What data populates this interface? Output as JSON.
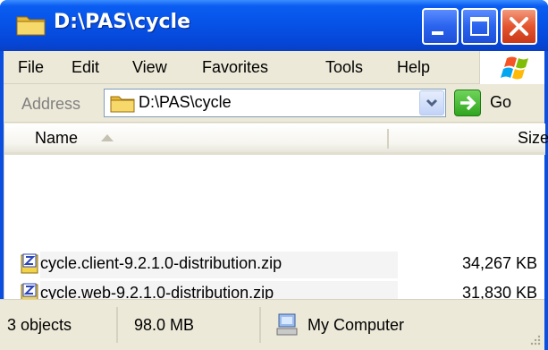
{
  "window": {
    "title": "D:\\PAS\\cycle",
    "controls": [
      "minimize",
      "maximize",
      "close"
    ]
  },
  "menu": {
    "items": [
      "File",
      "Edit",
      "View",
      "Favorites",
      "Tools",
      "Help"
    ]
  },
  "address_bar": {
    "label": "Address",
    "value": "D:\\PAS\\cycle",
    "go_label": "Go"
  },
  "list": {
    "columns": {
      "name": "Name",
      "size": "Size"
    },
    "files": [
      {
        "name": "cycle.client-9.2.1.0-distribution.zip",
        "size": "34,267 KB"
      },
      {
        "name": "cycle.web-9.2.1.0-distribution.zip",
        "size": "31,830 KB"
      }
    ]
  },
  "status": {
    "objects": "3 objects",
    "size": "98.0 MB",
    "location": "My Computer"
  },
  "colors": {
    "titlebar": "#0751e6",
    "close_button": "#e4542e",
    "window_face": "#ece9d8"
  }
}
